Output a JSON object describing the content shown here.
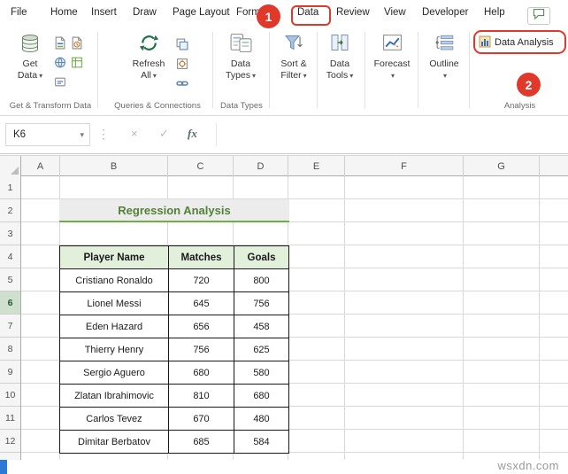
{
  "menu": {
    "tabs": [
      "File",
      "Home",
      "Insert",
      "Draw",
      "Page Layout",
      "Formulas",
      "Data",
      "Review",
      "View",
      "Developer",
      "Help"
    ],
    "active_tab": "Data"
  },
  "ribbon": {
    "big_buttons": [
      {
        "line1": "Get",
        "line2": "Data"
      },
      {
        "line1": "Refresh",
        "line2": "All"
      },
      {
        "line1": "Data",
        "line2": "Types"
      },
      {
        "line1": "Sort &",
        "line2": "Filter"
      },
      {
        "line1": "Data",
        "line2": "Tools"
      },
      {
        "line1": "Forecast",
        "line2": ""
      },
      {
        "line1": "Outline",
        "line2": ""
      }
    ],
    "data_analysis_label": "Data Analysis",
    "group_labels": [
      "Get & Transform Data",
      "Queries & Connections",
      "Data Types",
      "Analysis"
    ]
  },
  "formula_bar": {
    "name_box_value": "K6"
  },
  "icons": {
    "caret": "▾",
    "dots": "⋮",
    "cancel": "×",
    "check": "✓",
    "fx": "fx"
  },
  "annotations": {
    "step1": "1",
    "step2": "2"
  },
  "sheet": {
    "column_headers": [
      "A",
      "B",
      "C",
      "D",
      "E",
      "F",
      "G"
    ],
    "row_headers": [
      "1",
      "2",
      "3",
      "4",
      "5",
      "6",
      "7",
      "8",
      "9",
      "10",
      "11",
      "12"
    ],
    "active_row": "6",
    "title": "Regression Analysis",
    "table": {
      "headers": [
        "Player Name",
        "Matches",
        "Goals"
      ],
      "rows": [
        [
          "Cristiano Ronaldo",
          "720",
          "800"
        ],
        [
          "Lionel Messi",
          "645",
          "756"
        ],
        [
          "Eden Hazard",
          "656",
          "458"
        ],
        [
          "Thierry Henry",
          "756",
          "625"
        ],
        [
          "Sergio Aguero",
          "680",
          "580"
        ],
        [
          "Zlatan Ibrahimovic",
          "810",
          "680"
        ],
        [
          "Carlos Tevez",
          "670",
          "480"
        ],
        [
          "Dimitar Berbatov",
          "685",
          "584"
        ]
      ]
    }
  },
  "watermark": "wsxdn.com",
  "colors": {
    "annotation_red": "#E0392B",
    "excel_green": "#217346",
    "title_green": "#538135",
    "table_header_fill": "#E2EFDA",
    "title_underline": "#70AD47"
  }
}
